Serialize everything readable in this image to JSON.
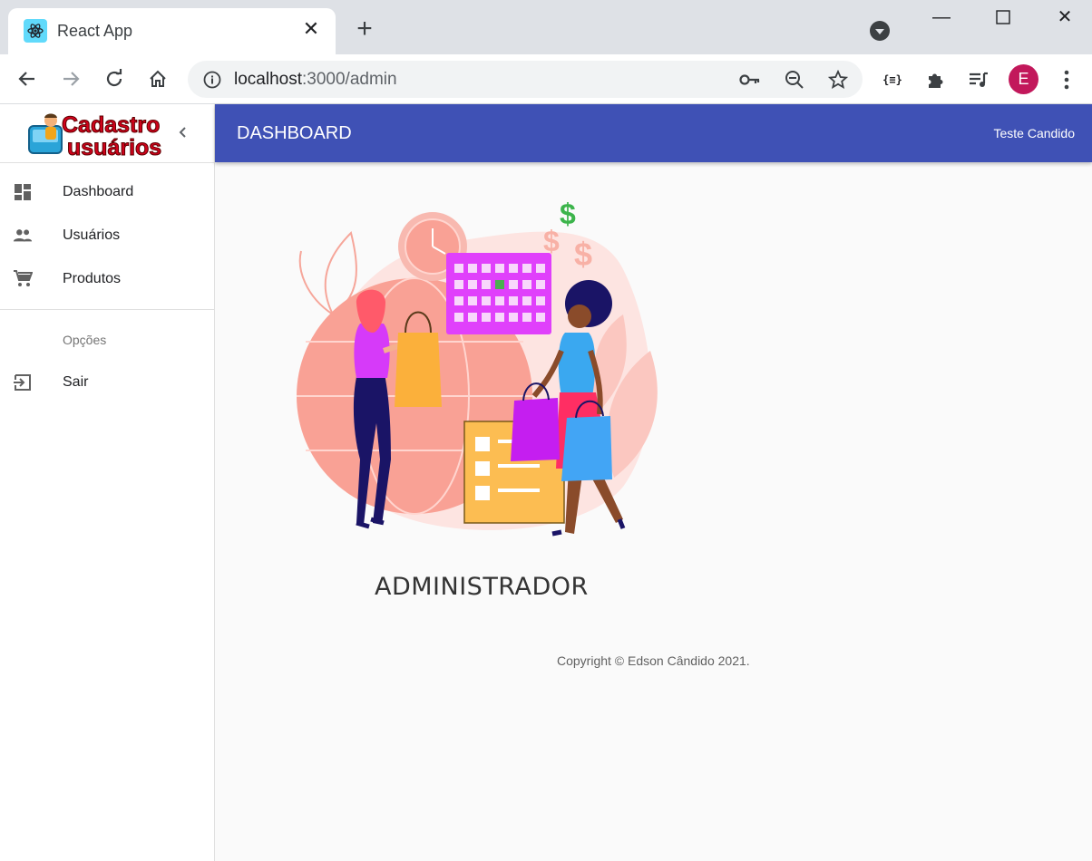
{
  "browser": {
    "tab_title": "React App",
    "url_host": "localhost",
    "url_rest": ":3000/admin",
    "profile_initial": "E"
  },
  "sidebar": {
    "logo_line1": "Cadastro",
    "logo_line2": "usuários",
    "items": [
      {
        "label": "Dashboard",
        "icon": "dashboard-icon"
      },
      {
        "label": "Usuários",
        "icon": "people-icon"
      },
      {
        "label": "Produtos",
        "icon": "cart-icon"
      }
    ],
    "section_header": "Opções",
    "secondary_items": [
      {
        "label": "Sair",
        "icon": "exit-icon"
      }
    ]
  },
  "appbar": {
    "title": "DASHBOARD",
    "user": "Teste Candido",
    "color": "#3f51b5"
  },
  "main": {
    "heading": "ADMINISTRADOR",
    "copyright": "Copyright © Edson Cândido 2021."
  }
}
